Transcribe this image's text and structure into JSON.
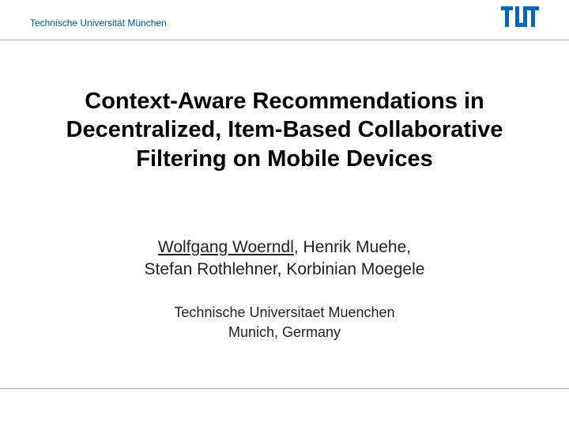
{
  "header": {
    "affiliation": "Technische Universität München",
    "logo_name": "tum-logo"
  },
  "title": {
    "line1": "Context-Aware Recommendations in",
    "line2": "Decentralized, Item-Based Collaborative",
    "line3": "Filtering on Mobile Devices"
  },
  "authors": {
    "lead": "Wolfgang Woerndl",
    "rest1": ", Henrik Muehe,",
    "line2": "Stefan Rothlehner, Korbinian Moegele"
  },
  "institution": {
    "line1": "Technische Universitaet Muenchen",
    "line2": "Munich, Germany"
  }
}
